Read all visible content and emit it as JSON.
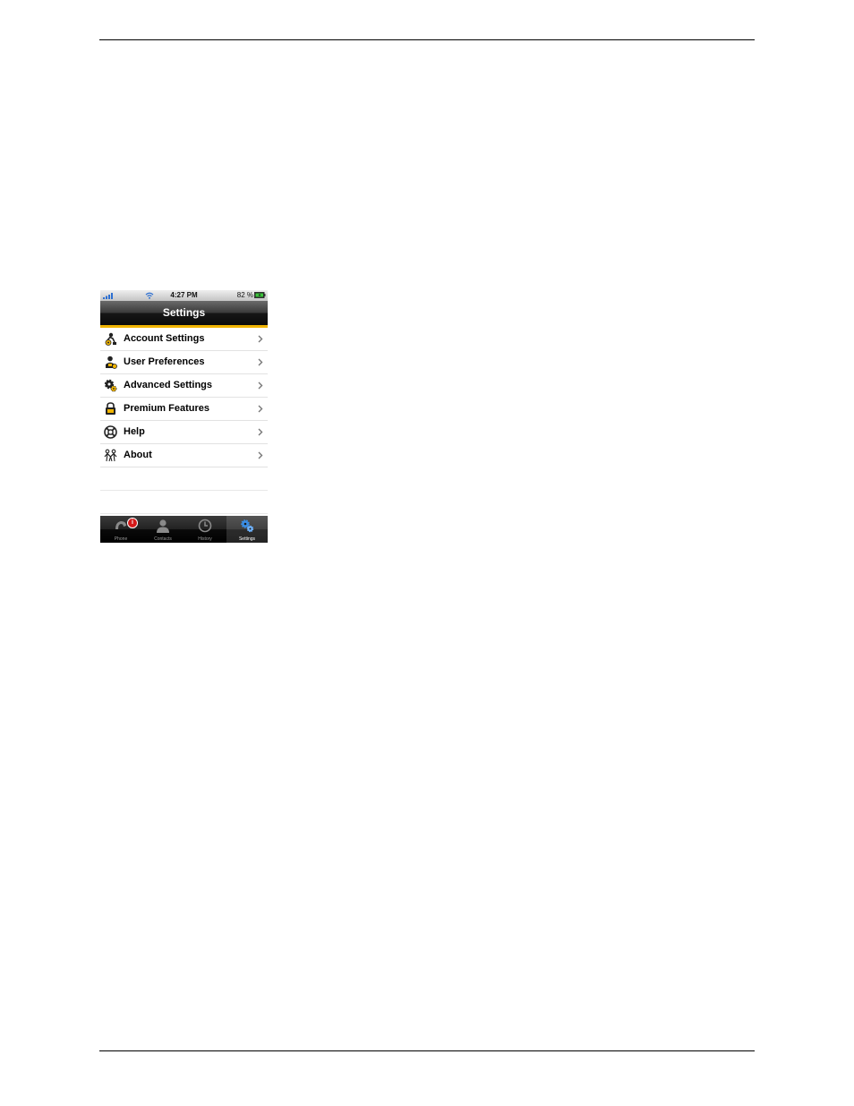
{
  "status_bar": {
    "time": "4:27 PM",
    "battery": "82 %"
  },
  "nav": {
    "title": "Settings"
  },
  "menu": {
    "items": [
      {
        "label": "Account Settings",
        "icon": "account-settings-icon"
      },
      {
        "label": "User Preferences",
        "icon": "user-preferences-icon"
      },
      {
        "label": "Advanced Settings",
        "icon": "gear-icon"
      },
      {
        "label": "Premium Features",
        "icon": "lock-icon"
      },
      {
        "label": "Help",
        "icon": "help-icon"
      },
      {
        "label": "About",
        "icon": "about-icon"
      }
    ]
  },
  "tabs": [
    {
      "label": "Phone",
      "icon": "phone-icon",
      "badge": "i"
    },
    {
      "label": "Contacts",
      "icon": "contacts-icon"
    },
    {
      "label": "History",
      "icon": "clock-icon"
    },
    {
      "label": "Settings",
      "icon": "settings-gears-icon",
      "active": true
    }
  ],
  "colors": {
    "accent": "#f0b400",
    "badge": "#d51a1a"
  }
}
